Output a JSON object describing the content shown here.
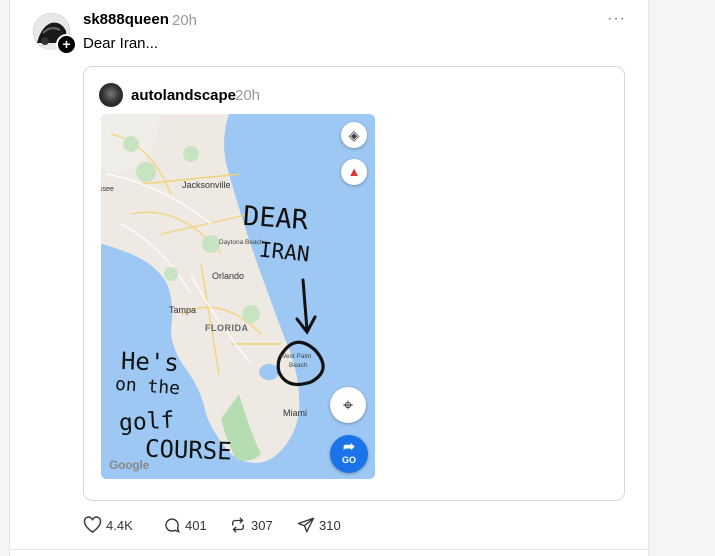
{
  "post": {
    "username": "sk888queen",
    "time": "20h",
    "text": "Dear Iran...",
    "more_icon": "···",
    "follow_badge": "+"
  },
  "quote": {
    "username": "autolandscape",
    "time": "20h",
    "map": {
      "labels": {
        "jacksonville": "Jacksonville",
        "daytona": "Daytona Beach",
        "orlando": "Orlando",
        "tampa": "Tampa",
        "florida": "FLORIDA",
        "west_palm": "West Palm",
        "beach": "Beach",
        "miami": "Miami",
        "edge_see": "ssee"
      },
      "handwriting": {
        "dear": "DEAR",
        "iran": "IRAN",
        "hes": "He's",
        "on_the": "on the",
        "golf": "golf",
        "course": "COURSE"
      },
      "go_label": "GO",
      "google_logo": "Google"
    }
  },
  "actions": {
    "likes": "4.4K",
    "replies": "401",
    "reposts": "307",
    "shares": "310"
  }
}
